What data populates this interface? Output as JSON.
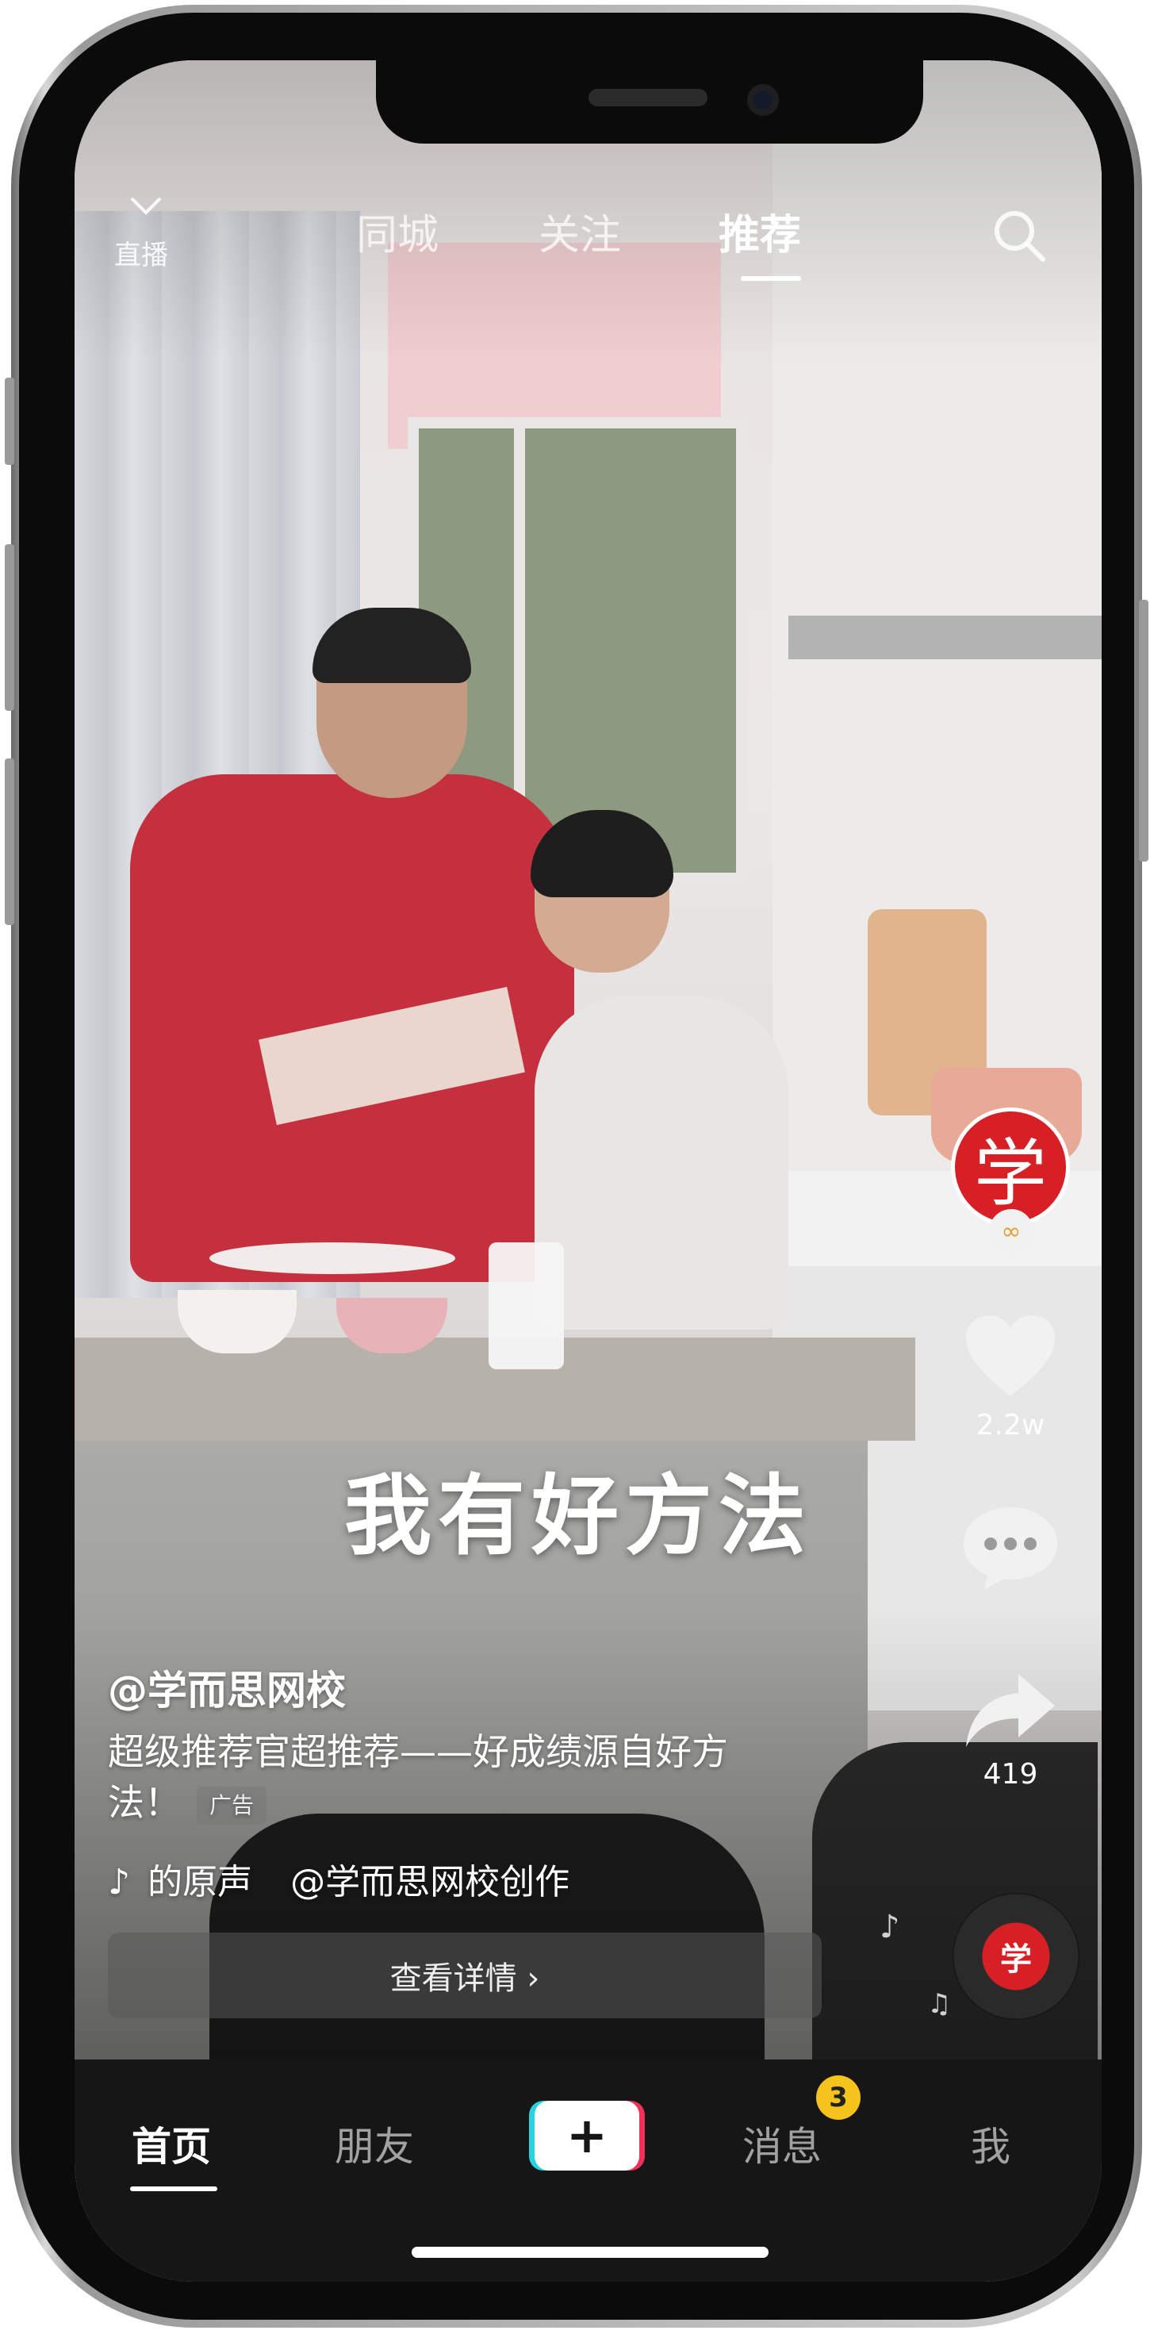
{
  "top_nav": {
    "live_label": "直播",
    "tabs": [
      {
        "label": "同城"
      },
      {
        "label": "关注"
      },
      {
        "label": "推荐"
      }
    ]
  },
  "video": {
    "caption_overlay": "我有好方法",
    "author": "@学而思网校",
    "description": "超级推荐官超推荐——好成绩源自好方法！",
    "ad_tag": "广告",
    "music_text": "的原声",
    "music_creator": "@学而思网校创作",
    "details_button": "查看详情 ›",
    "avatar_char": "学",
    "disc_char": "学"
  },
  "actions": {
    "like_count": "2.2w",
    "share_count": "419"
  },
  "bottom_nav": {
    "items": [
      {
        "label": "首页"
      },
      {
        "label": "朋友"
      },
      {
        "label": "消息"
      },
      {
        "label": "我"
      }
    ],
    "plus_label": "+",
    "message_badge": "3"
  },
  "colors": {
    "accent_cyan": "#27d3e0",
    "accent_red": "#f0325a",
    "badge_yellow": "#f6c21c",
    "brand_red": "#d71f26"
  }
}
